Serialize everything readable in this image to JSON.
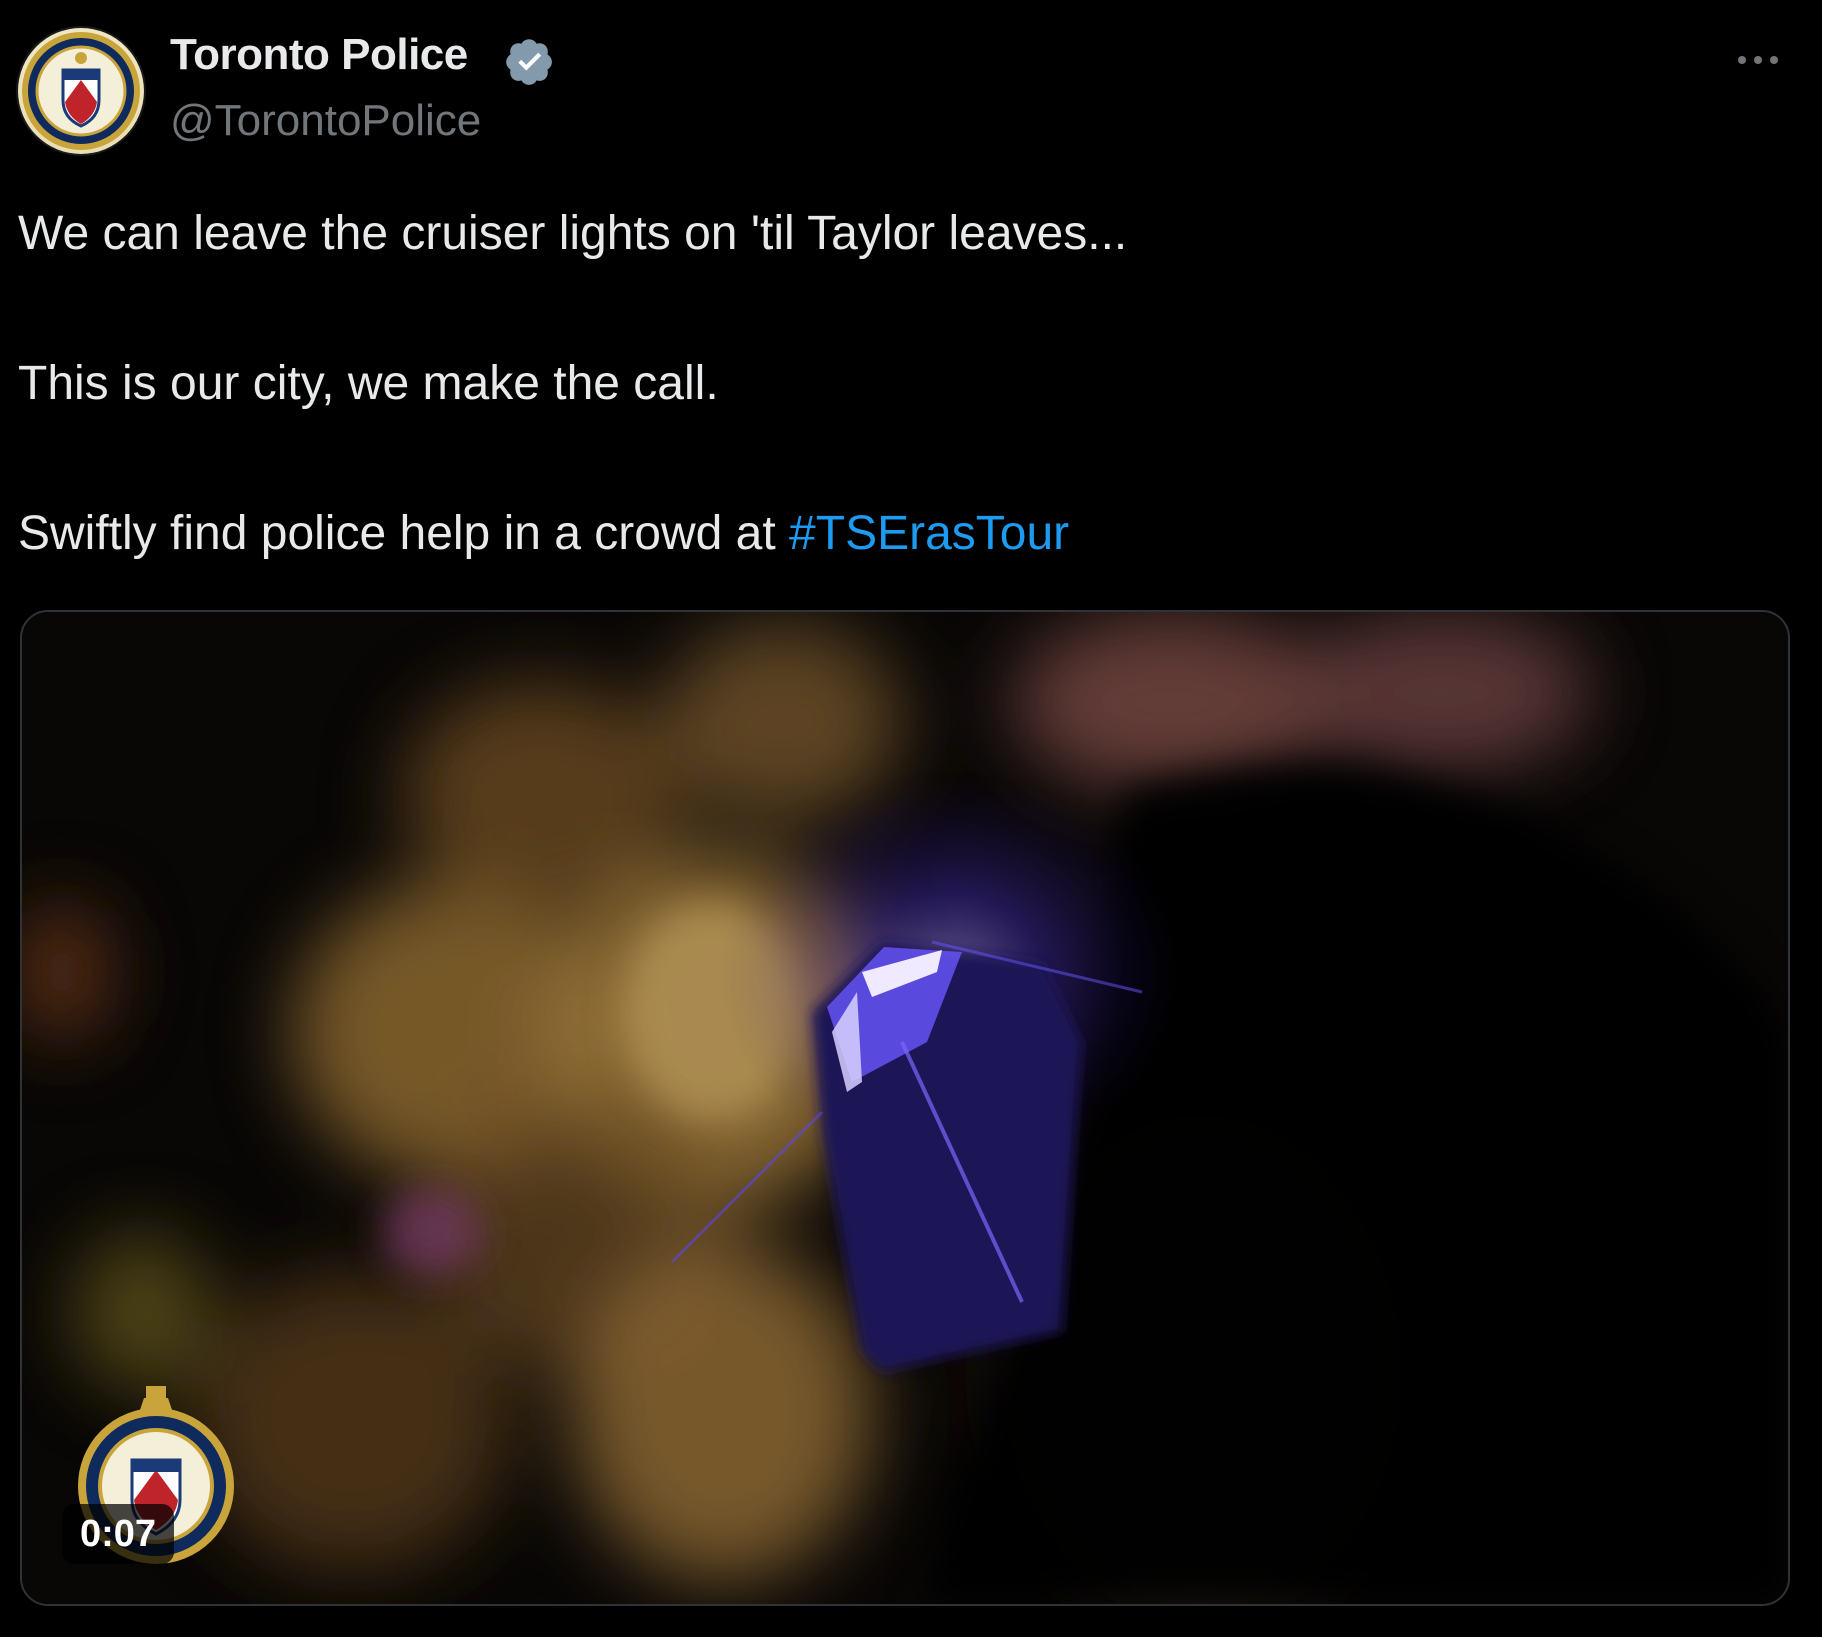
{
  "account": {
    "display_name": "Toronto Police",
    "handle": "@TorontoPolice",
    "verified": true,
    "avatar_icon": "toronto-police-crest-icon"
  },
  "menu": {
    "icon": "more-horizontal-icon"
  },
  "tweet": {
    "line1": "We can leave the cruiser lights on 'til Taylor leaves...",
    "line2": "This is our city, we make the call.",
    "line3_text": "Swiftly find police help in a crowd at ",
    "hashtag": "#TSErasTour"
  },
  "media": {
    "type": "video",
    "duration": "0:07",
    "watermark_icon": "toronto-police-crest-icon"
  },
  "colors": {
    "background": "#000000",
    "text": "#e7e9ea",
    "secondary_text": "#71767b",
    "link": "#1d9bf0",
    "verified_badge": "#829aab"
  }
}
